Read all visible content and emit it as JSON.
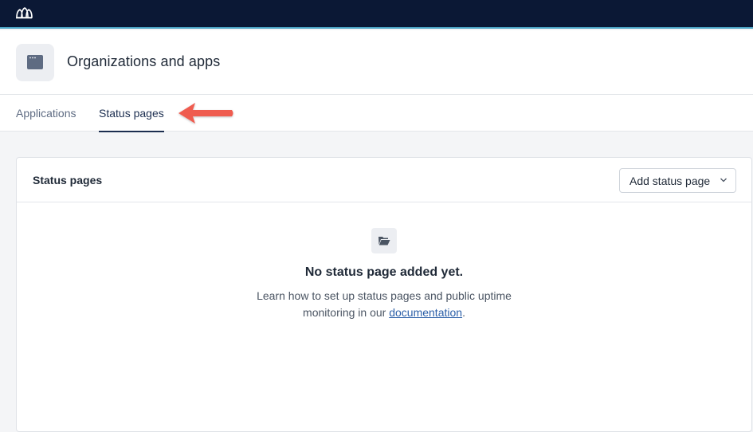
{
  "header": {
    "title": "Organizations and apps"
  },
  "tabs": [
    {
      "label": "Applications",
      "active": false
    },
    {
      "label": "Status pages",
      "active": true
    }
  ],
  "card": {
    "title": "Status pages",
    "add_button_label": "Add status page"
  },
  "empty_state": {
    "title": "No status page added yet.",
    "desc_line1": "Learn how to set up status pages and public uptime",
    "desc_line2_prefix": "monitoring in our ",
    "link_text": "documentation",
    "desc_line2_suffix": "."
  },
  "colors": {
    "topbar": "#0b1835",
    "accent_line": "#4aa3c4",
    "arrow": "#ef5b4f",
    "link": "#2b5fa8"
  },
  "icons": [
    "logo-icon",
    "app-window-icon",
    "arrow-annotation",
    "chevron-down-icon",
    "folder-open-icon"
  ]
}
